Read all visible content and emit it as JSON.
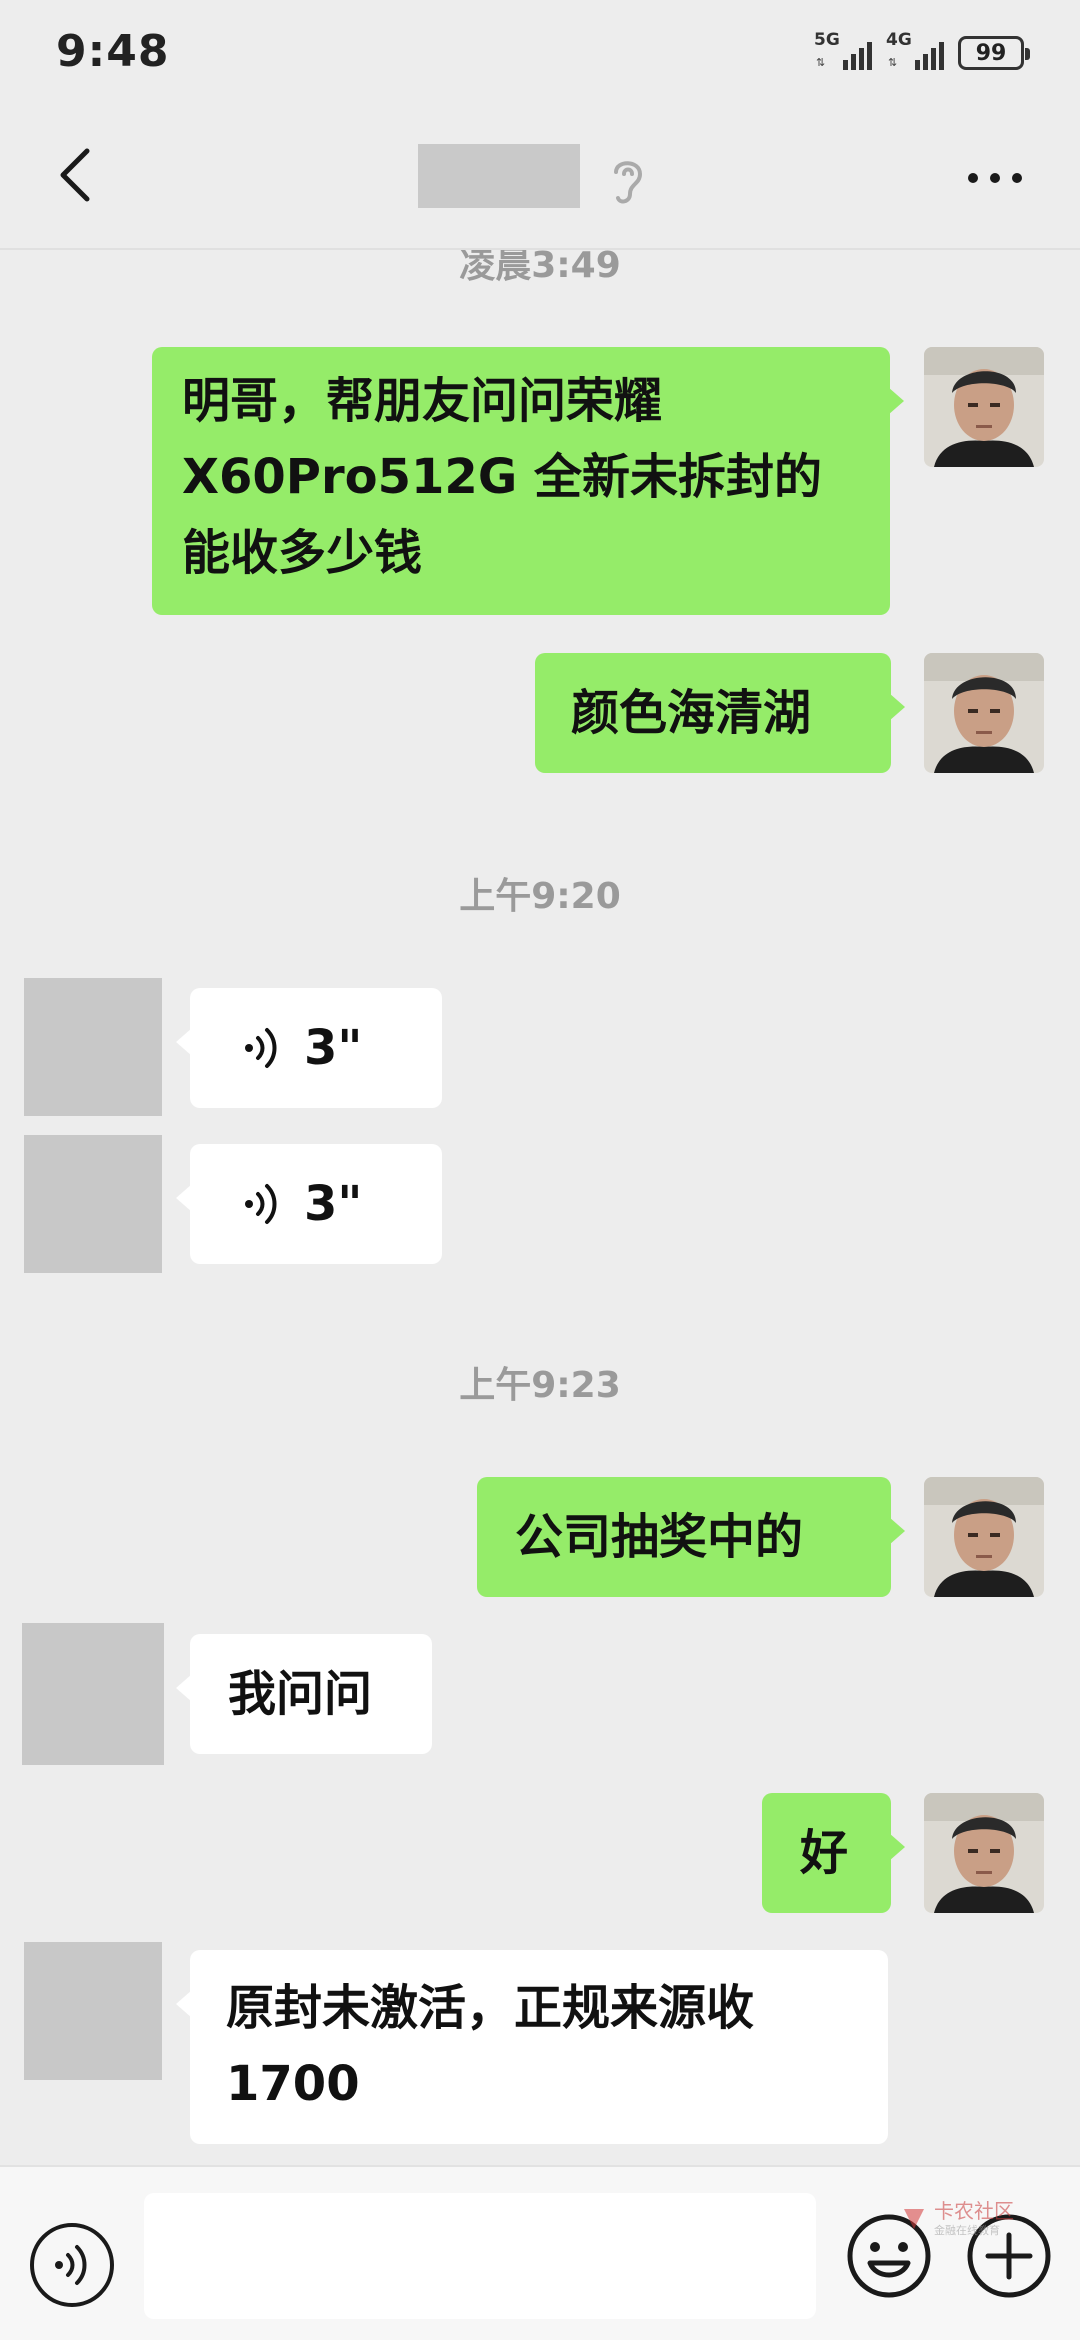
{
  "status_bar": {
    "time": "9:48",
    "signal1_label": "5G",
    "signal2_label": "4G",
    "battery": "99"
  },
  "header": {
    "more_label": "···"
  },
  "messages": {
    "ts_partial": "凌晨3:49",
    "m1": [
      "明哥，帮朋友问问荣耀",
      "X60Pro512G 全新未拆封的",
      "能收多少钱"
    ],
    "m2": "颜色海清湖",
    "ts1": "上午9:20",
    "voice1": "3\"",
    "voice2": "3\"",
    "ts2": "上午9:23",
    "m3": "公司抽奖中的",
    "m4": "我问问",
    "m5": "好",
    "m6": [
      "原封未激活，正规来源收",
      "1700"
    ]
  },
  "watermark": {
    "title": "卡农社区",
    "subtitle": "金融在线教育"
  },
  "colors": {
    "bubble_me": "#95ec69",
    "bubble_them": "#ffffff",
    "background": "#ededed"
  }
}
